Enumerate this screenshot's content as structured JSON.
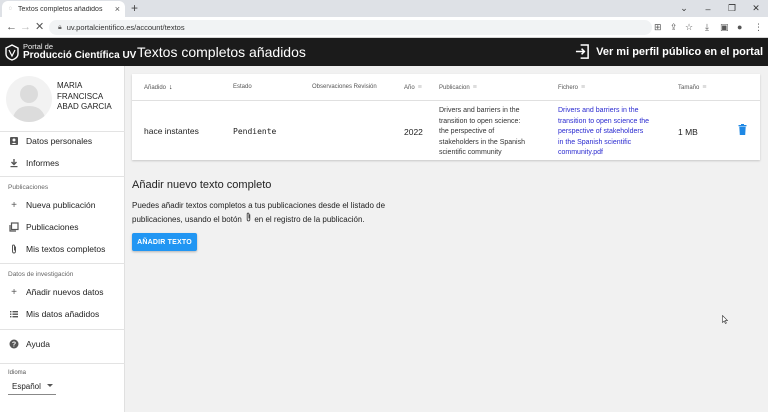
{
  "browser": {
    "tab_title": "Textos completos añadidos",
    "url": "uv.portalcientifico.es/account/textos"
  },
  "app": {
    "logo_line1": "Portal de",
    "logo_line2": "Producció Científica UV",
    "page_title": "Textos completos añadidos",
    "profile_link": "Ver mi perfil público en el portal"
  },
  "user": {
    "name_lines": [
      "MARIA",
      "FRANCISCA",
      "ABAD GARCIA"
    ]
  },
  "sidebar": {
    "datos_personales": "Datos personales",
    "informes": "Informes",
    "publicaciones_header": "Publicaciones",
    "nueva_publicacion": "Nueva publicación",
    "publicaciones": "Publicaciones",
    "mis_textos": "Mis textos completos",
    "investigacion_header": "Datos de investigación",
    "anadir_datos": "Añadir nuevos datos",
    "mis_datos": "Mis datos añadidos",
    "ayuda": "Ayuda",
    "idioma_label": "Idioma",
    "idioma_value": "Español"
  },
  "table": {
    "headers": {
      "anadido": "Añadido",
      "estado": "Estado",
      "observaciones": "Observaciones Revisión",
      "anio": "Año",
      "publicacion": "Publicacion",
      "fichero": "Fichero",
      "tamano": "Tamaño"
    },
    "rows": [
      {
        "anadido": "hace instantes",
        "estado": "Pendiente",
        "observaciones": "",
        "anio": "2022",
        "publicacion_lines": [
          "Drivers and barriers in the",
          "transition to open science:",
          "the perspective of",
          "stakeholders in the Spanish",
          "scientific community"
        ],
        "fichero_lines": [
          "Drivers and barriers in the",
          "transition to open science the",
          "perspective of stakeholders",
          "in the Spanish scientific",
          "community.pdf"
        ],
        "tamano": "1 MB"
      }
    ]
  },
  "add_section": {
    "title": "Añadir nuevo texto completo",
    "desc_line1": "Puedes añadir textos completos a tus publicaciones desde el listado de",
    "desc_line2_pre": "publicaciones, usando el botón",
    "desc_line2_post": "en el registro de la publicación.",
    "button": "AÑADIR TEXTO"
  },
  "colors": {
    "appbar": "#1b1b1b",
    "accent": "#2196f3",
    "link": "#2a2ad0"
  }
}
